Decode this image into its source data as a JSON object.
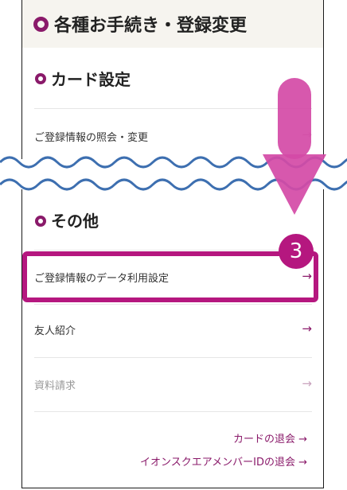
{
  "page": {
    "title": "各種お手続き・登録変更"
  },
  "card_section": {
    "title": "カード設定",
    "items": [
      {
        "label": "ご登録情報の照会・変更",
        "arrow": "→"
      }
    ]
  },
  "other_section": {
    "title": "その他",
    "items": [
      {
        "label": "ご登録情報のデータ利用設定",
        "arrow": "→"
      },
      {
        "label": "友人紹介",
        "arrow": "→"
      },
      {
        "label": "資料請求",
        "arrow": "→"
      }
    ]
  },
  "links": [
    {
      "label": "カードの退会 →"
    },
    {
      "label": "イオンスクエアメンバーIDの退会 →"
    }
  ],
  "annotation": {
    "step": "3"
  },
  "colors": {
    "accent": "#b5177f",
    "wave": "#3d6fb0",
    "down_arrow": "#d44aa6"
  },
  "icons": {
    "bullet": "ring-icon",
    "chevron": "arrow-right-icon",
    "down": "down-arrow-icon"
  }
}
